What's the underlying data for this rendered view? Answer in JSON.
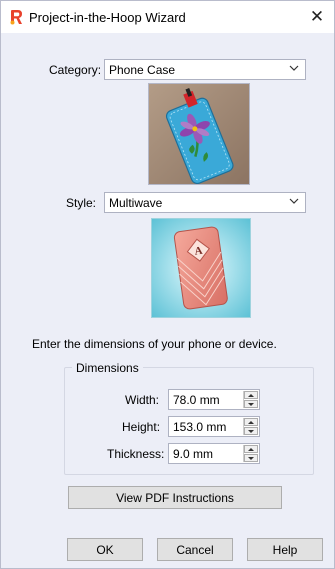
{
  "window": {
    "title": "Project-in-the-Hoop Wizard",
    "close_glyph": "✕",
    "accent": "#e8412c",
    "background": "#eceef7"
  },
  "category": {
    "label": "Category:",
    "value": "Phone Case"
  },
  "style": {
    "label": "Style:",
    "value": "Multiwave"
  },
  "instructions": "Enter the dimensions of your phone or device.",
  "dimensions": {
    "group_title": "Dimensions",
    "width": {
      "label": "Width:",
      "value": "78.0 mm"
    },
    "height": {
      "label": "Height:",
      "value": "153.0 mm"
    },
    "thickness": {
      "label": "Thickness:",
      "value": "9.0 mm"
    }
  },
  "buttons": {
    "pdf": "View PDF Instructions",
    "ok": "OK",
    "cancel": "Cancel",
    "help": "Help"
  },
  "icons": {
    "app": "wizard-app-icon",
    "close": "close-icon",
    "dropdown": "chevron-down-icon",
    "spin_up": "spin-up-icon",
    "spin_down": "spin-down-icon"
  }
}
